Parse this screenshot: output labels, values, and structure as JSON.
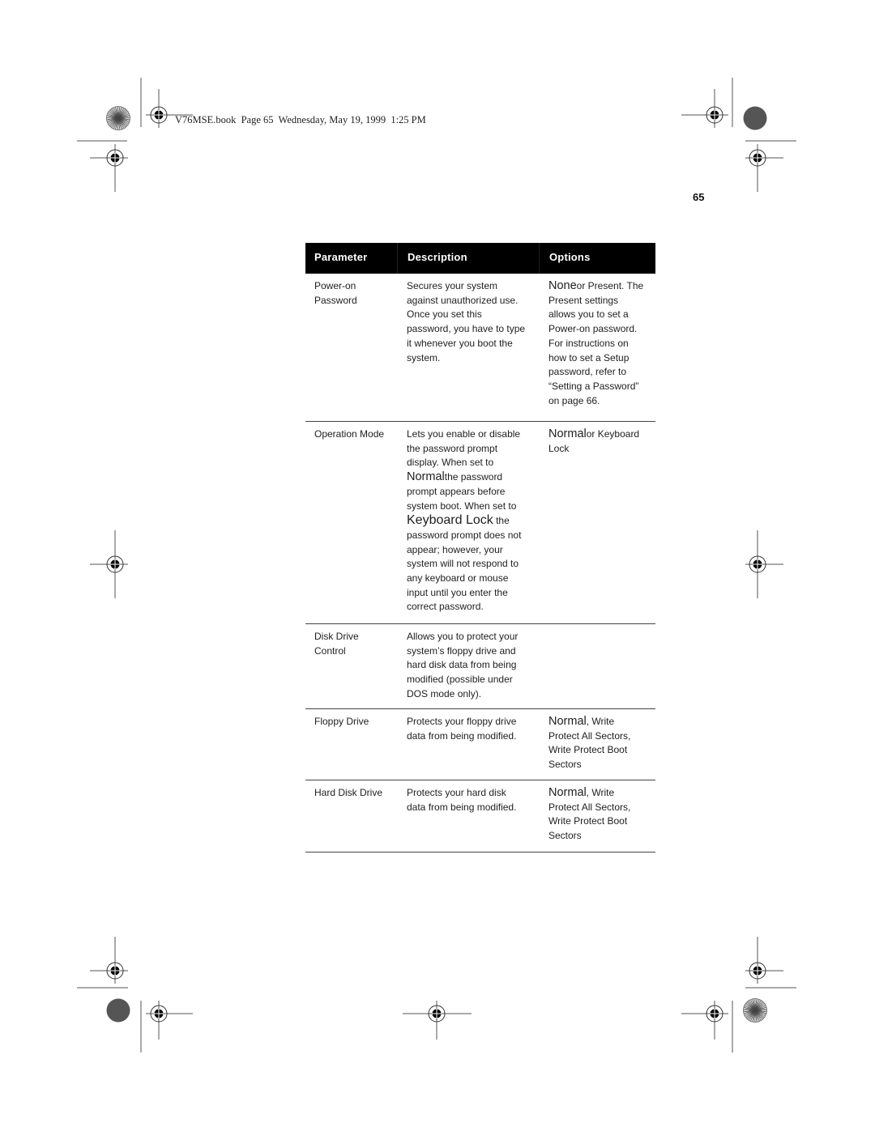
{
  "header_slug": "V76MSE.book  Page 65  Wednesday, May 19, 1999  1:25 PM",
  "page_number": "65",
  "table": {
    "columns": [
      "Parameter",
      "Description",
      "Options"
    ],
    "rows": [
      {
        "parameter": "Power-on\nPassword",
        "description": "Secures your system\nagainst unauthorized use.\nOnce you set this\npassword, you have to type\nit whenever you boot the\nsystem.",
        "options_lead": "None",
        "options": "or Present.  The\nPresent settings\nallows you to set a\nPower-on password.\nFor instructions on\nhow to set a Setup\npassword, refer to\n“Setting a Password”\non page 66."
      },
      {
        "parameter": "Operation Mode",
        "description_parts": [
          "Lets you enable or disable\nthe password prompt\ndisplay.  When set to",
          "Normal",
          "the password\nprompt appears before\nsystem boot.  When set to",
          "Keyboard Lock",
          "the\npassword prompt does not\nappear; however, your\nsystem will not respond to\nany keyboard or mouse\ninput until you enter the\ncorrect password."
        ],
        "options_lead": "Normal",
        "options": "or Keyboard\nLock"
      },
      {
        "parameter": "Disk Drive\nControl",
        "description": "Allows you to protect your\nsystem’s floppy drive and\nhard disk data from being\nmodified (possible under\nDOS mode only).",
        "options_lead": "",
        "options": ""
      },
      {
        "parameter": "Floppy Drive",
        "description": "Protects your floppy drive\ndata from being modified.",
        "options_lead": "Normal",
        "options": ", Write\nProtect All Sectors,\nWrite Protect Boot\nSectors"
      },
      {
        "parameter": "Hard Disk Drive",
        "description": "Protects your hard disk\ndata from being modified.",
        "options_lead": "Normal",
        "options": ", Write\nProtect All Sectors,\nWrite Protect Boot\nSectors"
      }
    ]
  }
}
